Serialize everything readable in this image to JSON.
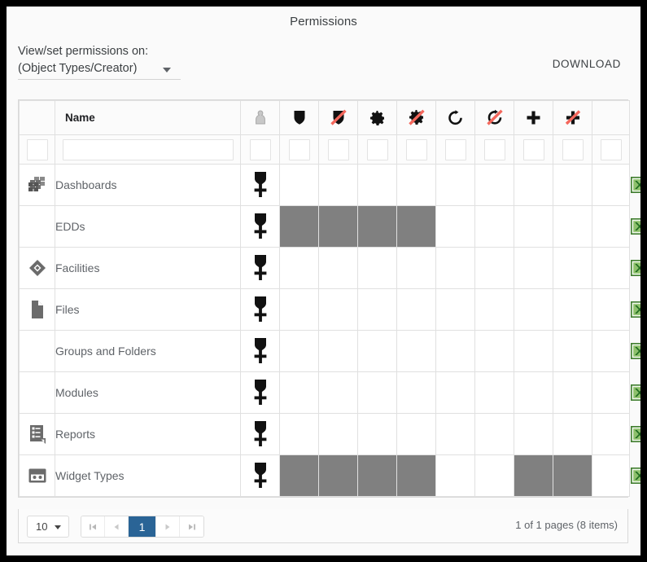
{
  "header": {
    "title": "Permissions",
    "picker_label": "View/set permissions on:",
    "picker_value": "(Object Types/Creator)",
    "download_label": "DOWNLOAD"
  },
  "grid": {
    "columns": [
      {
        "key": "obj_icon",
        "label": "",
        "icon": "object-type-icon"
      },
      {
        "key": "name",
        "label": "Name",
        "icon": ""
      },
      {
        "key": "p_owner",
        "label": "",
        "icon": "lock-pawn-icon"
      },
      {
        "key": "p_view",
        "label": "",
        "icon": "shield-icon"
      },
      {
        "key": "p_view_deny",
        "label": "",
        "icon": "shield-slash-icon"
      },
      {
        "key": "p_config",
        "label": "",
        "icon": "gear-icon"
      },
      {
        "key": "p_config_deny",
        "label": "",
        "icon": "gear-slash-icon"
      },
      {
        "key": "p_refresh",
        "label": "",
        "icon": "refresh-icon"
      },
      {
        "key": "p_refresh_deny",
        "label": "",
        "icon": "refresh-slash-icon"
      },
      {
        "key": "p_create",
        "label": "",
        "icon": "plus-icon"
      },
      {
        "key": "p_create_deny",
        "label": "",
        "icon": "plus-slash-icon"
      },
      {
        "key": "export",
        "label": "",
        "icon": ""
      }
    ],
    "filter_placeholder": "",
    "filter_value": "",
    "row_marker_icon": "medal-icon",
    "export_icon": "excel-export-icon",
    "rows": [
      {
        "name": "Dashboards",
        "icon": "dashboards-icon",
        "perms": [
          "medal",
          "",
          "",
          "",
          "",
          "",
          "",
          "",
          "",
          ""
        ]
      },
      {
        "name": "EDDs",
        "icon": "",
        "perms": [
          "medal",
          "denied",
          "denied",
          "denied",
          "denied",
          "",
          "",
          "",
          "",
          ""
        ]
      },
      {
        "name": "Facilities",
        "icon": "facilities-icon",
        "perms": [
          "medal",
          "",
          "",
          "",
          "",
          "",
          "",
          "",
          "",
          ""
        ]
      },
      {
        "name": "Files",
        "icon": "files-icon",
        "perms": [
          "medal",
          "",
          "",
          "",
          "",
          "",
          "",
          "",
          "",
          ""
        ]
      },
      {
        "name": "Groups and Folders",
        "icon": "",
        "perms": [
          "medal",
          "",
          "",
          "",
          "",
          "",
          "",
          "",
          "",
          ""
        ]
      },
      {
        "name": "Modules",
        "icon": "",
        "perms": [
          "medal",
          "",
          "",
          "",
          "",
          "",
          "",
          "",
          "",
          ""
        ]
      },
      {
        "name": "Reports",
        "icon": "reports-icon",
        "perms": [
          "medal",
          "",
          "",
          "",
          "",
          "",
          "",
          "",
          "",
          ""
        ]
      },
      {
        "name": "Widget Types",
        "icon": "widget-types-icon",
        "perms": [
          "medal",
          "denied",
          "denied",
          "denied",
          "denied",
          "",
          "",
          "denied",
          "denied",
          ""
        ]
      }
    ]
  },
  "footer": {
    "page_size": "10",
    "first_icon": "first-page-icon",
    "prev_icon": "prev-page-icon",
    "current_page": "1",
    "next_icon": "next-page-icon",
    "last_icon": "last-page-icon",
    "page_info": "1 of 1 pages (8 items)"
  },
  "colors": {
    "denied_cell": "#808080",
    "active_page": "#2a6496",
    "deny_slash": "#f4675c",
    "excel_green": "#3f7d2e",
    "frame": "#000000",
    "page_bg": "#fafafa"
  }
}
